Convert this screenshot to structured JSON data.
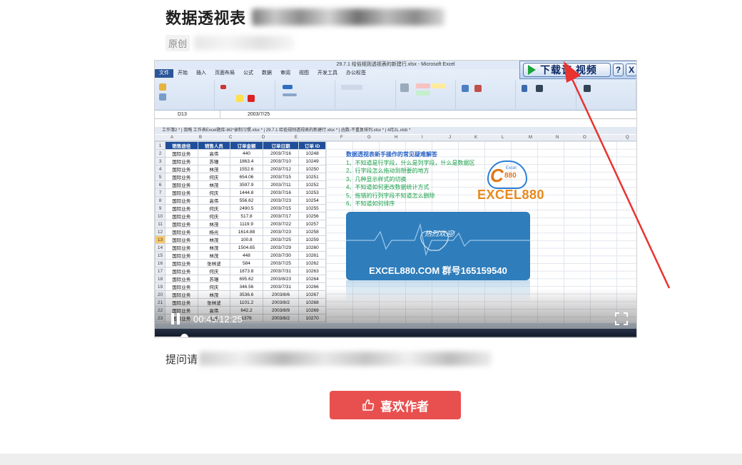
{
  "article": {
    "title": "数据透视表",
    "original_tag": "原创",
    "question_label": "提问请"
  },
  "video": {
    "excel": {
      "window_title": "29.7.1 给俗规则透视表的新建行.xlsx - Microsoft Excel",
      "tabs": [
        "文件",
        "开始",
        "插入",
        "页面布局",
        "公式",
        "数据",
        "审阅",
        "视图",
        "开发工具",
        "办公标签"
      ],
      "name_box": "D13",
      "formula_value": "2003/7/25",
      "sheet_tabs": "工作簿2 * | 我略 工作表Excel题库-8G*录制习惯.xlsx * | 29.7.1 给俗规则透视表的新建行.xlsx * | 函数-不重复排列.xlsx * | 4月2L.xlsb *",
      "columns": [
        "A",
        "B",
        "C",
        "D",
        "E",
        "F",
        "G",
        "H",
        "I",
        "J",
        "K",
        "L",
        "M",
        "N",
        "O",
        "Q"
      ],
      "headers": [
        "销售途径",
        "销售人员",
        "订单金额",
        "订单日期",
        "订单 ID"
      ],
      "rows": [
        [
          "国际业务",
          "高伟",
          "440",
          "2003/7/16",
          "10248"
        ],
        [
          "国际业务",
          "苏珊",
          "1863.4",
          "2003/7/10",
          "10249"
        ],
        [
          "国际业务",
          "林茂",
          "1552.6",
          "2003/7/12",
          "10250"
        ],
        [
          "国际业务",
          "何庆",
          "654.06",
          "2003/7/15",
          "10251"
        ],
        [
          "国际业务",
          "林茂",
          "3597.9",
          "2003/7/11",
          "10252"
        ],
        [
          "国际业务",
          "何庆",
          "1444.8",
          "2003/7/16",
          "10253"
        ],
        [
          "国际业务",
          "高伟",
          "556.62",
          "2003/7/23",
          "10254"
        ],
        [
          "国际业务",
          "何庆",
          "2490.5",
          "2003/7/15",
          "10255"
        ],
        [
          "国际业务",
          "何庆",
          "517.8",
          "2003/7/17",
          "10256"
        ],
        [
          "国际业务",
          "林茂",
          "1119.9",
          "2003/7/22",
          "10257"
        ],
        [
          "国际业务",
          "杨光",
          "1614.88",
          "2003/7/23",
          "10258"
        ],
        [
          "国际业务",
          "林茂",
          "100.8",
          "2003/7/25",
          "10259"
        ],
        [
          "国际业务",
          "林茂",
          "1504.65",
          "2003/7/29",
          "10260"
        ],
        [
          "国际业务",
          "林茂",
          "448",
          "2003/7/30",
          "10261"
        ],
        [
          "国际业务",
          "张林波",
          "584",
          "2003/7/25",
          "10262"
        ],
        [
          "国际业务",
          "何庆",
          "1873.8",
          "2003/7/31",
          "10263"
        ],
        [
          "国际业务",
          "苏珊",
          "695.62",
          "2003/8/23",
          "10264"
        ],
        [
          "国际业务",
          "何庆",
          "346.56",
          "2003/7/31",
          "10266"
        ],
        [
          "国际业务",
          "林茂",
          "3536.6",
          "2003/8/6",
          "10267"
        ],
        [
          "国际业务",
          "张林波",
          "1101.2",
          "2003/8/2",
          "10268"
        ],
        [
          "国际业务",
          "高伟",
          "642.2",
          "2003/8/9",
          "10269"
        ],
        [
          "国际业务",
          "杨光",
          "1376",
          "2003/8/2",
          "10270"
        ]
      ],
      "help_title": "数据透视表新手操作的常见疑难解答",
      "help_items": [
        "1、不知道是行字段，什么是列字段，什么是数据区",
        "2、行字段怎么拖动到想要的地方",
        "3、几种显示样式的切换",
        "4、不知道如何更改数据统计方式",
        "5、拖错的行列字段不知道怎么删除",
        "6、不知道如何排序"
      ],
      "logo_small": "Excel",
      "logo_number": "880",
      "logo_brand": "EXCEL880",
      "banner_welcome": "热烈欢迎!",
      "banner_text": "EXCEL880.COM 群号165159540"
    },
    "download_button": "下载该 视频",
    "help_button": "?",
    "close_button": "X",
    "time": "00:45/12:25",
    "progress": 0.06
  },
  "like_button": "喜欢作者",
  "colors": {
    "like": "#e8504f",
    "arrow": "#e8332f",
    "excel_header": "#1f4e9a",
    "help_text": "#1aa04a"
  }
}
